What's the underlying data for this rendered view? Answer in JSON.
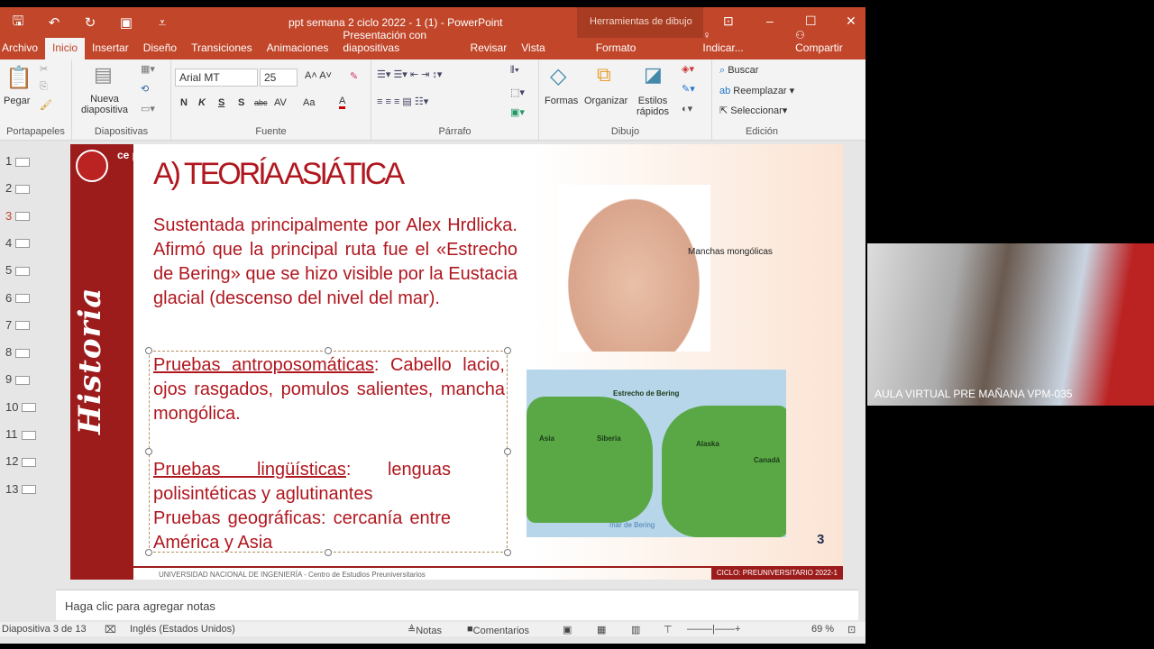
{
  "window": {
    "title": "ppt semana 2 ciclo 2022 - 1 (1) - PowerPoint",
    "context_tab": "Herramientas de dibujo"
  },
  "tabs": [
    "Archivo",
    "Inicio",
    "Insertar",
    "Diseño",
    "Transiciones",
    "Animaciones",
    "Presentación con diapositivas",
    "Revisar",
    "Vista",
    "Formato"
  ],
  "tell_me": "Indicar...",
  "share": "Compartir",
  "ribbon": {
    "clipboard": {
      "paste": "Pegar",
      "label": "Portapapeles"
    },
    "slides": {
      "new": "Nueva diapositiva",
      "label": "Diapositivas"
    },
    "font": {
      "name": "Arial MT",
      "size": "25",
      "bold": "N",
      "italic": "K",
      "underline": "S",
      "shadow": "S",
      "strike": "abc",
      "spacing": "AV",
      "case": "Aa",
      "label": "Fuente"
    },
    "paragraph": {
      "label": "Párrafo"
    },
    "drawing": {
      "shapes": "Formas",
      "arrange": "Organizar",
      "styles": "Estilos rápidos",
      "label": "Dibujo"
    },
    "editing": {
      "find": "Buscar",
      "replace": "Reemplazar",
      "select": "Seleccionar",
      "label": "Edición"
    }
  },
  "thumbnails": [
    "1",
    "2",
    "3",
    "4",
    "5",
    "6",
    "7",
    "8",
    "9",
    "10",
    "11",
    "12",
    "13"
  ],
  "current_slide": 3,
  "slide": {
    "brand": "ce pre UNI",
    "side_title": "Historia",
    "title": "A) TEORÍA  ASIÁTICA",
    "p1": "Sustentada principalmente por Alex Hrdlicka. Afirmó que la principal ruta fue el «Estrecho de Bering» que se hizo visible por la Eustacia glacial (descenso del nivel del mar).",
    "b1_head": "Pruebas antroposomáticas",
    "b1_text": ": Cabello lacio, ojos rasgados, pomulos salientes, mancha mongólica.",
    "b2_head": "Pruebas lingüísticas",
    "b2_text": ": lenguas polisintéticas y aglutinantes",
    "b3": "Pruebas geográficas: cercanía entre América y Asia",
    "baby_label": "Manchas mongólicas",
    "map_labels": {
      "strait": "Estrecho de Bering",
      "asia": "Asia",
      "siberia": "Siberia",
      "alaska": "Alaska",
      "canada": "Canadá",
      "sea": "mar de Bering"
    },
    "page_number": "3",
    "footer_left": "UNIVERSIDAD NACIONAL DE INGENIERÍA - Centro de Estudios Preuniversitarios",
    "footer_right": "CICLO: PREUNIVERSITARIO 2022-1"
  },
  "notes_placeholder": "Haga clic para agregar notas",
  "status": {
    "slide": "Diapositiva 3 de 13",
    "language": "Inglés (Estados Unidos)",
    "notes": "Notas",
    "comments": "Comentarios",
    "zoom": "69 %"
  },
  "camera": {
    "label": "AULA VIRTUAL PRE MAÑANA VPM-035"
  }
}
